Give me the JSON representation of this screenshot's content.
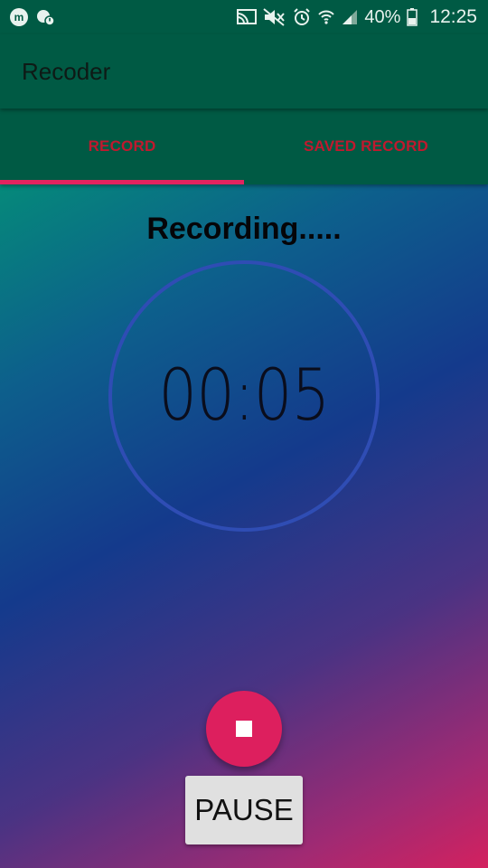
{
  "status_bar": {
    "left_icons": [
      "messenger-icon",
      "notification-icon"
    ],
    "right_icons": [
      "cast-icon",
      "mute-icon",
      "alarm-icon",
      "wifi-icon",
      "signal-icon",
      "battery-icon"
    ],
    "battery": "40%",
    "time": "12:25"
  },
  "app": {
    "title": "Recoder"
  },
  "tabs": [
    {
      "label": "RECORD",
      "selected": true
    },
    {
      "label": "SAVED RECORD",
      "selected": false
    }
  ],
  "recorder": {
    "status": "Recording.....",
    "timer": "00:05",
    "stop_icon": "stop-icon",
    "pause_label": "PAUSE"
  },
  "colors": {
    "primary": "#005a44",
    "accent": "#e3235f",
    "tab_text": "#c0192e"
  }
}
